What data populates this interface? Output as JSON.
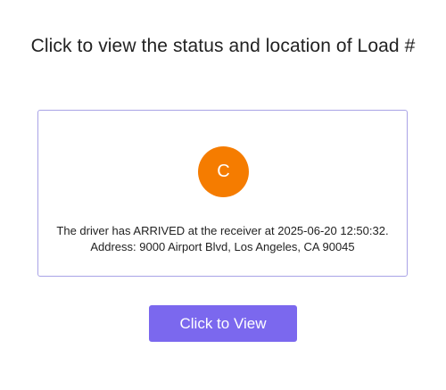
{
  "page": {
    "title": "Click to view the status and location of Load #"
  },
  "card": {
    "avatar_initial": "C",
    "status_text": "The driver has ARRIVED at the receiver at 2025-06-20 12:50:32.",
    "address_text": "Address: 9000 Airport Blvd, Los Angeles, CA 90045"
  },
  "action": {
    "view_label": "Click to View"
  },
  "colors": {
    "avatar_bg": "#f57c00",
    "button_bg": "#7b68ee",
    "card_border": "#a9a3e6"
  }
}
